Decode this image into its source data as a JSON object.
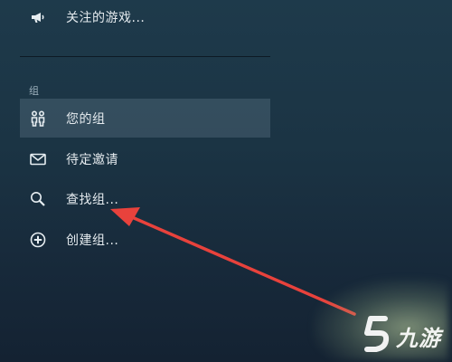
{
  "menu": {
    "top_item": {
      "label": "关注的游戏...",
      "icon": "megaphone-icon"
    },
    "section_title": "组",
    "items": [
      {
        "label": "您的组",
        "icon": "group-icon",
        "selected": true
      },
      {
        "label": "待定邀请",
        "icon": "envelope-icon",
        "selected": false
      },
      {
        "label": "查找组...",
        "icon": "search-icon",
        "selected": false
      },
      {
        "label": "创建组...",
        "icon": "plus-circle-icon",
        "selected": false
      }
    ]
  },
  "annotation": {
    "arrow_color": "#e8423c"
  },
  "watermark": {
    "text": "九游",
    "color": "#ffffff"
  }
}
